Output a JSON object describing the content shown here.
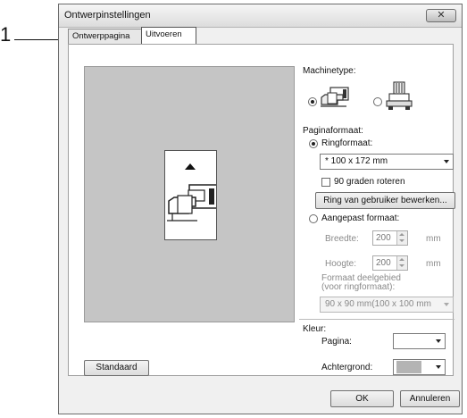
{
  "callout": {
    "number": "1"
  },
  "window": {
    "title": "Ontwerpinstellingen",
    "close_glyph": "✕"
  },
  "tabs": [
    {
      "label": "Ontwerppagina",
      "active": false
    },
    {
      "label": "Uitvoeren",
      "active": true
    }
  ],
  "machine": {
    "label": "Machinetype:",
    "options": [
      {
        "icon": "embroidery-machine-icon",
        "selected": true
      },
      {
        "icon": "multi-needle-machine-icon",
        "selected": false
      }
    ]
  },
  "page_format": {
    "label": "Paginaformaat:",
    "hoop_option": {
      "label": "Ringformaat:",
      "selected": true
    },
    "hoop_size": "* 100 x 172 mm",
    "rotate": {
      "label": "90 graden roteren",
      "checked": false
    },
    "custom_hoop_button": "Ring van gebruiker bewerken...",
    "custom_option": {
      "label": "Aangepast formaat:",
      "selected": false
    },
    "width": {
      "label": "Breedte:",
      "value": "200",
      "unit": "mm"
    },
    "height": {
      "label": "Hoogte:",
      "value": "200",
      "unit": "mm"
    },
    "section_label_1": "Formaat deelgebied",
    "section_label_2": "(voor ringformaat):",
    "section_size": "90 x  90 mm(100 x 100 mm"
  },
  "color": {
    "label": "Kleur:",
    "page": {
      "label": "Pagina:",
      "swatch": "#ffffff"
    },
    "background": {
      "label": "Achtergrond:",
      "swatch": "#b4b4b4"
    }
  },
  "buttons": {
    "default": "Standaard",
    "ok": "OK",
    "cancel": "Annuleren"
  },
  "colors": {
    "preview_bg": "#c5c5c5",
    "dialog_bg": "#f0f0f0"
  }
}
